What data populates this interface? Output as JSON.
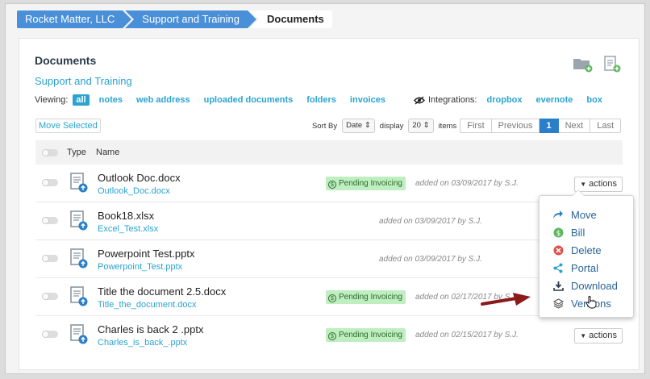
{
  "breadcrumb": [
    "Rocket Matter, LLC",
    "Support and Training",
    "Documents"
  ],
  "page": {
    "title": "Documents",
    "subtitle": "Support and Training"
  },
  "viewing": {
    "label": "Viewing:",
    "filters": [
      "all",
      "notes",
      "web address",
      "uploaded documents",
      "folders",
      "invoices"
    ],
    "active": "all",
    "integrations_label": "Integrations:",
    "integrations": [
      "dropbox",
      "evernote",
      "box"
    ]
  },
  "toolbar": {
    "move_selected": "Move Selected",
    "sort_by_label": "Sort By",
    "sort_by_value": "Date",
    "display_label": "display",
    "display_value": "20",
    "items_label": "items",
    "pager": [
      "First",
      "Previous",
      "1",
      "Next",
      "Last"
    ]
  },
  "table": {
    "headers": {
      "type": "Type",
      "name": "Name"
    },
    "rows": [
      {
        "name": "Outlook Doc.docx",
        "file": "Outlook_Doc.docx",
        "badge": "Pending Invoicing",
        "added": "added on 03/09/2017 by S.J.",
        "actions": "actions"
      },
      {
        "name": "Book18.xlsx",
        "file": "Excel_Test.xlsx",
        "badge": "",
        "added": "added on 03/09/2017 by S.J.",
        "actions": ""
      },
      {
        "name": "Powerpoint Test.pptx",
        "file": "Powerpoint_Test.pptx",
        "badge": "",
        "added": "added on 03/09/2017 by S.J.",
        "actions": ""
      },
      {
        "name": "Title the document 2.5.docx",
        "file": "Title_the_document.docx",
        "badge": "Pending Invoicing",
        "added": "added on 02/17/2017 by S.J.",
        "actions": ""
      },
      {
        "name": "Charles is back 2 .pptx",
        "file": "Charles_is_back_.pptx",
        "badge": "Pending Invoicing",
        "added": "added on 02/15/2017 by S.J.",
        "actions": "actions"
      }
    ]
  },
  "menu": [
    "Move",
    "Bill",
    "Delete",
    "Portal",
    "Download",
    "Versions"
  ],
  "colors": {
    "accent": "#2aa4cf",
    "breadcrumb": "#4a90d9",
    "badge_bg": "#bfeec0",
    "pager_active": "#2a7fc9",
    "arrow": "#8b1a1a"
  }
}
